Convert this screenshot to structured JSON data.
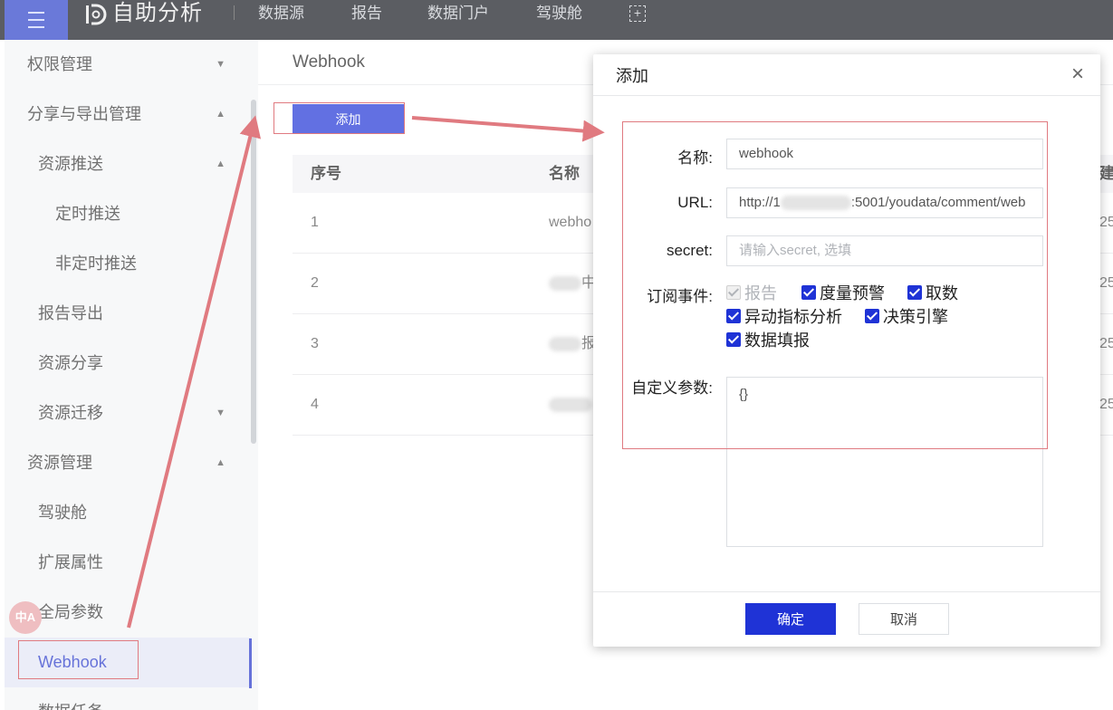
{
  "topbar": {
    "app_title": "自助分析",
    "nav": [
      "数据源",
      "报告",
      "数据门户",
      "驾驶舱"
    ]
  },
  "sidebar": {
    "items": [
      {
        "label": "权限管理",
        "arrow": "▼"
      },
      {
        "label": "分享与导出管理",
        "arrow": "▲"
      },
      {
        "label": "资源推送",
        "arrow": "▲"
      },
      {
        "label": "定时推送",
        "arrow": ""
      },
      {
        "label": "非定时推送",
        "arrow": ""
      },
      {
        "label": "报告导出",
        "arrow": ""
      },
      {
        "label": "资源分享",
        "arrow": ""
      },
      {
        "label": "资源迁移",
        "arrow": "▼"
      },
      {
        "label": "资源管理",
        "arrow": "▲"
      },
      {
        "label": "驾驶舱",
        "arrow": ""
      },
      {
        "label": "扩展属性",
        "arrow": ""
      },
      {
        "label": "全局参数",
        "arrow": ""
      },
      {
        "label": "Webhook",
        "arrow": ""
      },
      {
        "label": "数据任务",
        "arrow": ""
      }
    ],
    "translate_badge": "中A"
  },
  "main": {
    "page_title": "Webhook",
    "add_button": "添加",
    "table": {
      "headers": [
        "序号",
        "名称",
        "建"
      ],
      "rows": [
        {
          "index": "1",
          "name": "webho",
          "tail": "25"
        },
        {
          "index": "2",
          "name": "中",
          "tail": "25"
        },
        {
          "index": "3",
          "name": "报",
          "tail": "25"
        },
        {
          "index": "4",
          "name": "",
          "tail": "25"
        }
      ]
    }
  },
  "modal": {
    "title": "添加",
    "close_icon": "×",
    "name_label": "名称:",
    "name_value": "webhook",
    "url_label": "URL:",
    "url_prefix": "http://1",
    "url_suffix": ":5001/youdata/comment/web",
    "secret_label": "secret:",
    "secret_placeholder": "请输入secret, 选填",
    "events_label": "订阅事件:",
    "events": [
      {
        "label": "报告",
        "checked": true,
        "disabled": true
      },
      {
        "label": "度量预警",
        "checked": true,
        "disabled": false
      },
      {
        "label": "取数",
        "checked": true,
        "disabled": false
      },
      {
        "label": "异动指标分析",
        "checked": true,
        "disabled": false
      },
      {
        "label": "决策引擎",
        "checked": true,
        "disabled": false
      },
      {
        "label": "数据填报",
        "checked": true,
        "disabled": false
      }
    ],
    "params_label": "自定义参数:",
    "params_value": "{}",
    "ok_button": "确定",
    "cancel_button": "取消"
  },
  "colors": {
    "primary": "#1f33d6",
    "topbar": "#15181f",
    "annotation": "#e07a80"
  }
}
